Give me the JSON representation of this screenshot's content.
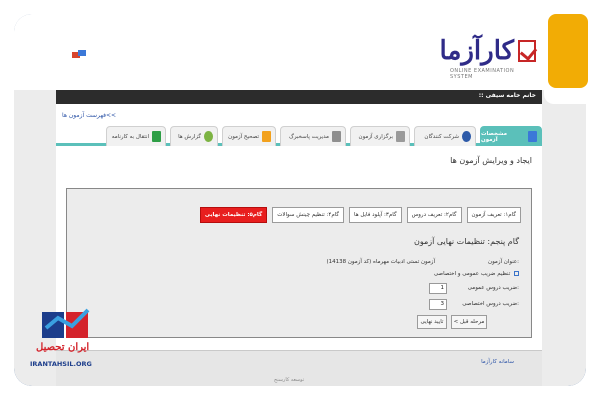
{
  "header": {
    "logo_text": "کارآزما",
    "logo_subtitle": "ONLINE EXAMINATION SYSTEM",
    "user_greeting": ":: خانم خامه سیفی"
  },
  "nav": {
    "exam_list_link": "فهرست آزمون ها<<",
    "tabs": [
      {
        "label": "مشخصات آزمون",
        "active": true,
        "icon": "wrench-icon"
      },
      {
        "label": "شرکت کنندگان",
        "active": false,
        "icon": "person-icon"
      },
      {
        "label": "برگزاری آزمون",
        "active": false,
        "icon": "hold-exam-icon"
      },
      {
        "label": "مدیریت پاسخبرگ",
        "active": false,
        "icon": "answer-sheet-icon"
      },
      {
        "label": "تصحیح آزمون",
        "active": false,
        "icon": "grading-icon"
      },
      {
        "label": "گزارش ها",
        "active": false,
        "icon": "chart-icon"
      },
      {
        "label": "انتقال به کارنامه",
        "active": false,
        "icon": "transfer-icon"
      }
    ]
  },
  "main": {
    "page_title": "ایجاد و ویرایش آزمون ها",
    "wizard": {
      "steps": [
        {
          "label": "گام۱: تعریف آزمون",
          "current": false
        },
        {
          "label": "گام۲: تعریف دروس",
          "current": false
        },
        {
          "label": "گام۳: آپلود فایل ها",
          "current": false
        },
        {
          "label": "گام۴: تنظیم چینش سوالات",
          "current": false
        },
        {
          "label": "گام۵: تنظیمات نهایی",
          "current": true
        }
      ],
      "step_title": "گام پنجم: تنظیمات نهایی آزمون",
      "exam_title_label": "عنوان آزمون:",
      "exam_title_value": "آزمون تستی ادبیات مهرماه (کد آزمون 14138)",
      "coef_setting_label": "تنظیم ضریب عمومی و اختصاصی",
      "general_coef_label": "ضریب دروس عمومی:",
      "general_coef_value": "1",
      "special_coef_label": "ضریب دروس اختصاصی:",
      "special_coef_value": "3",
      "prev_button": "< مرحله قبل",
      "confirm_button": "تایید نهایی"
    }
  },
  "footer": {
    "link": "سامانه کارآزما",
    "credit": "توسعه کارسنج"
  },
  "watermark": {
    "name": "ایران تحصیل",
    "url": "IRANTAHSIL.ORG"
  },
  "colors": {
    "frame": "#2f5d9c",
    "accent_teal": "#5bc0ba",
    "step_current": "#e81e1e",
    "orange_tile": "#f2ac05"
  }
}
